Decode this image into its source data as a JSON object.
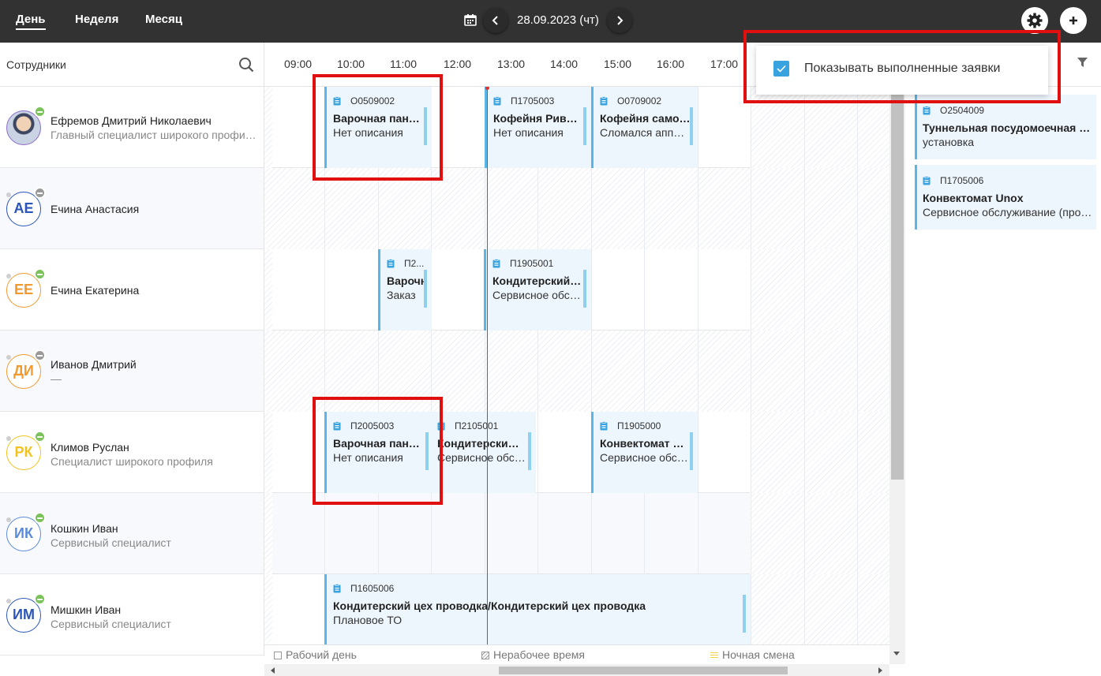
{
  "toolbar": {
    "tabs": [
      "День",
      "Неделя",
      "Месяц"
    ],
    "date": "28.09.2023 (чт)"
  },
  "employees_header": "Сотрудники",
  "hours": [
    "09:00",
    "10:00",
    "11:00",
    "12:00",
    "13:00",
    "14:00",
    "15:00",
    "16:00",
    "17:00"
  ],
  "employees": [
    {
      "initials": "",
      "name": "Ефремов Дмитрий Николаевич",
      "role": "Главный специалист широкого профиля",
      "photo": true,
      "status": "green"
    },
    {
      "initials": "АЕ",
      "name": "Ечина Анастасия",
      "role": "",
      "color": "#2b55b8",
      "status": "gray"
    },
    {
      "initials": "ЕЕ",
      "name": "Ечина Екатерина",
      "role": "",
      "color": "#f29a2e",
      "status": "green"
    },
    {
      "initials": "ДИ",
      "name": "Иванов Дмитрий",
      "role": "—",
      "color": "#f29a2e",
      "status": "gray"
    },
    {
      "initials": "РК",
      "name": "Климов Руслан",
      "role": "Специалист широкого профиля",
      "color": "#f2c21e",
      "status": "green"
    },
    {
      "initials": "ИК",
      "name": "Кошкин Иван",
      "role": "Сервисный специалист",
      "color": "#5a8ad8",
      "status": "green"
    },
    {
      "initials": "ИМ",
      "name": "Мишкин Иван",
      "role": "Сервисный специалист",
      "color": "#2b55b8",
      "status": "green"
    }
  ],
  "events": [
    {
      "code": "О0509002",
      "title": "Варочная панель",
      "desc": "Нет описания"
    },
    {
      "code": "П1705003",
      "title": "Кофейня Ривьера",
      "desc": "Нет описания"
    },
    {
      "code": "О0709002",
      "title": "Кофейня самообслуживания",
      "desc": "Сломался аппарат"
    },
    {
      "code": "П2...",
      "title": "Варочная",
      "desc": "Заказ"
    },
    {
      "code": "П1905001",
      "title": "Кондитерский цех",
      "desc": "Сервисное обслуживание"
    },
    {
      "code": "П2005003",
      "title": "Варочная панель",
      "desc": "Нет описания"
    },
    {
      "code": "П2105001",
      "title": "Кондитерский цех",
      "desc": "Сервисное обслуживание"
    },
    {
      "code": "П1905000",
      "title": "Конвектомат Unox",
      "desc": "Сервисное обслуживание"
    },
    {
      "code": "П1605006",
      "title": "Кондитерский цех проводка/Кондитерский цех проводка",
      "desc": "Плановое ТО"
    }
  ],
  "unassigned": [
    {
      "code": "О2504009",
      "title": "Туннельная посудомоечная машина",
      "desc": "установка"
    },
    {
      "code": "П1705006",
      "title": "Конвектомат Unox",
      "desc": "Сервисное обслуживание (профилактика)"
    }
  ],
  "legend": {
    "work_day": "Рабочий день",
    "off_time": "Нерабочее время",
    "night_shift": "Ночная смена"
  },
  "settings_popup": {
    "checkbox_label": "Показывать выполненные заявки",
    "checked": true
  },
  "colors": {
    "topbar": "#323232",
    "event_accent": "#5ab6e8",
    "now_line": "#e23030",
    "highlight": "#e01010",
    "checkbox": "#39a3e0"
  }
}
